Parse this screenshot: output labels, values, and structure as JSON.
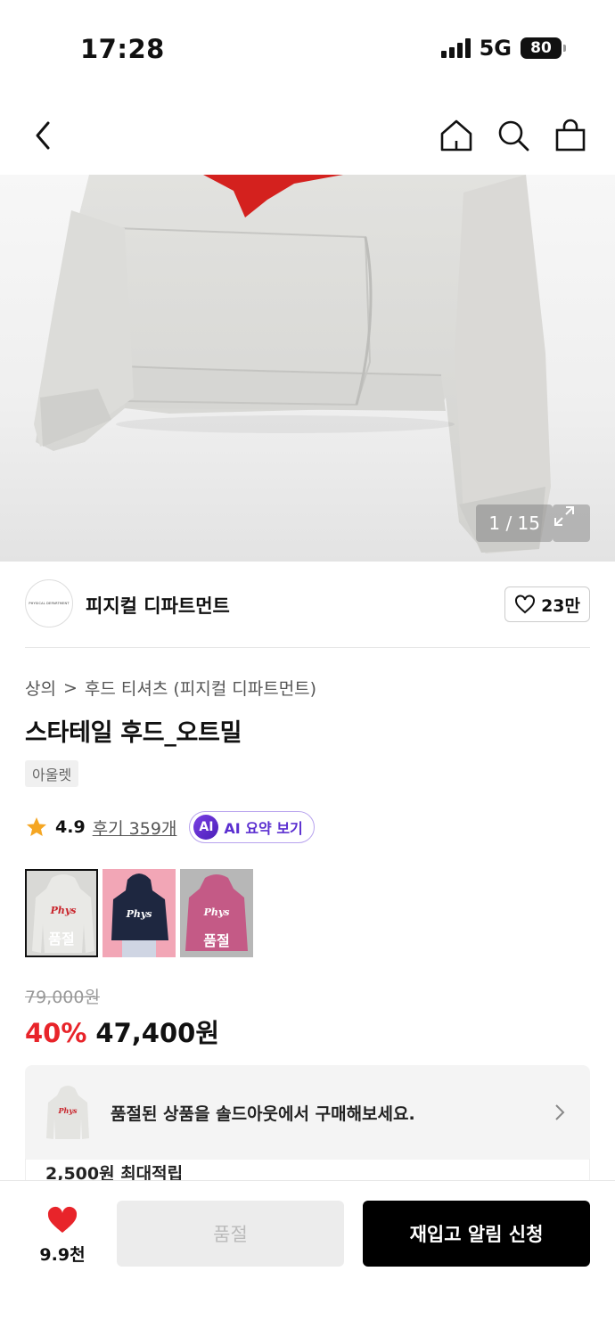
{
  "status_bar": {
    "time": "17:28",
    "network": "5G",
    "battery": "80"
  },
  "icons": {
    "back": "chevron-left-icon",
    "home": "home-icon",
    "search": "search-icon",
    "cart": "shopping-bag-icon",
    "expand": "expand-icon",
    "star": "star-icon",
    "heart": "heart-icon",
    "chevron": "chevron-right-icon"
  },
  "gallery": {
    "counter": "1 / 15"
  },
  "brand": {
    "name": "피지컬 디파트먼트",
    "logo_text": "PHYSICAL DEPARTMENT",
    "likes": "23만"
  },
  "breadcrumb": {
    "category": "상의",
    "separator": ">",
    "subcategory": "후드 티셔츠 (피지컬 디파트먼트)"
  },
  "product": {
    "title": "스타테일 후드_오트밀",
    "tag": "아울렛",
    "rating": "4.9",
    "reviews": "후기 359개",
    "ai_badge": "AI",
    "ai_summary": "AI 요약 보기"
  },
  "swatches": [
    {
      "label": "품절",
      "color": "#d9d9d6"
    },
    {
      "label": "",
      "color": "#f2a6b6"
    },
    {
      "label": "품절",
      "color": "#c45a86"
    }
  ],
  "price": {
    "original": "79,000원",
    "discount": "40%",
    "current": "47,400원"
  },
  "banner": {
    "text": "품절된 상품을 솔드아웃에서 구매해보세요.",
    "points": "2,500원 최대적립"
  },
  "bottom": {
    "like_count": "9.9천",
    "soldout_label": "품절",
    "alert_label": "재입고 알림 신청"
  },
  "colors": {
    "accent_red": "#e8242a",
    "heart_red": "#e8242a",
    "ai_purple": "#5b2fd0"
  }
}
